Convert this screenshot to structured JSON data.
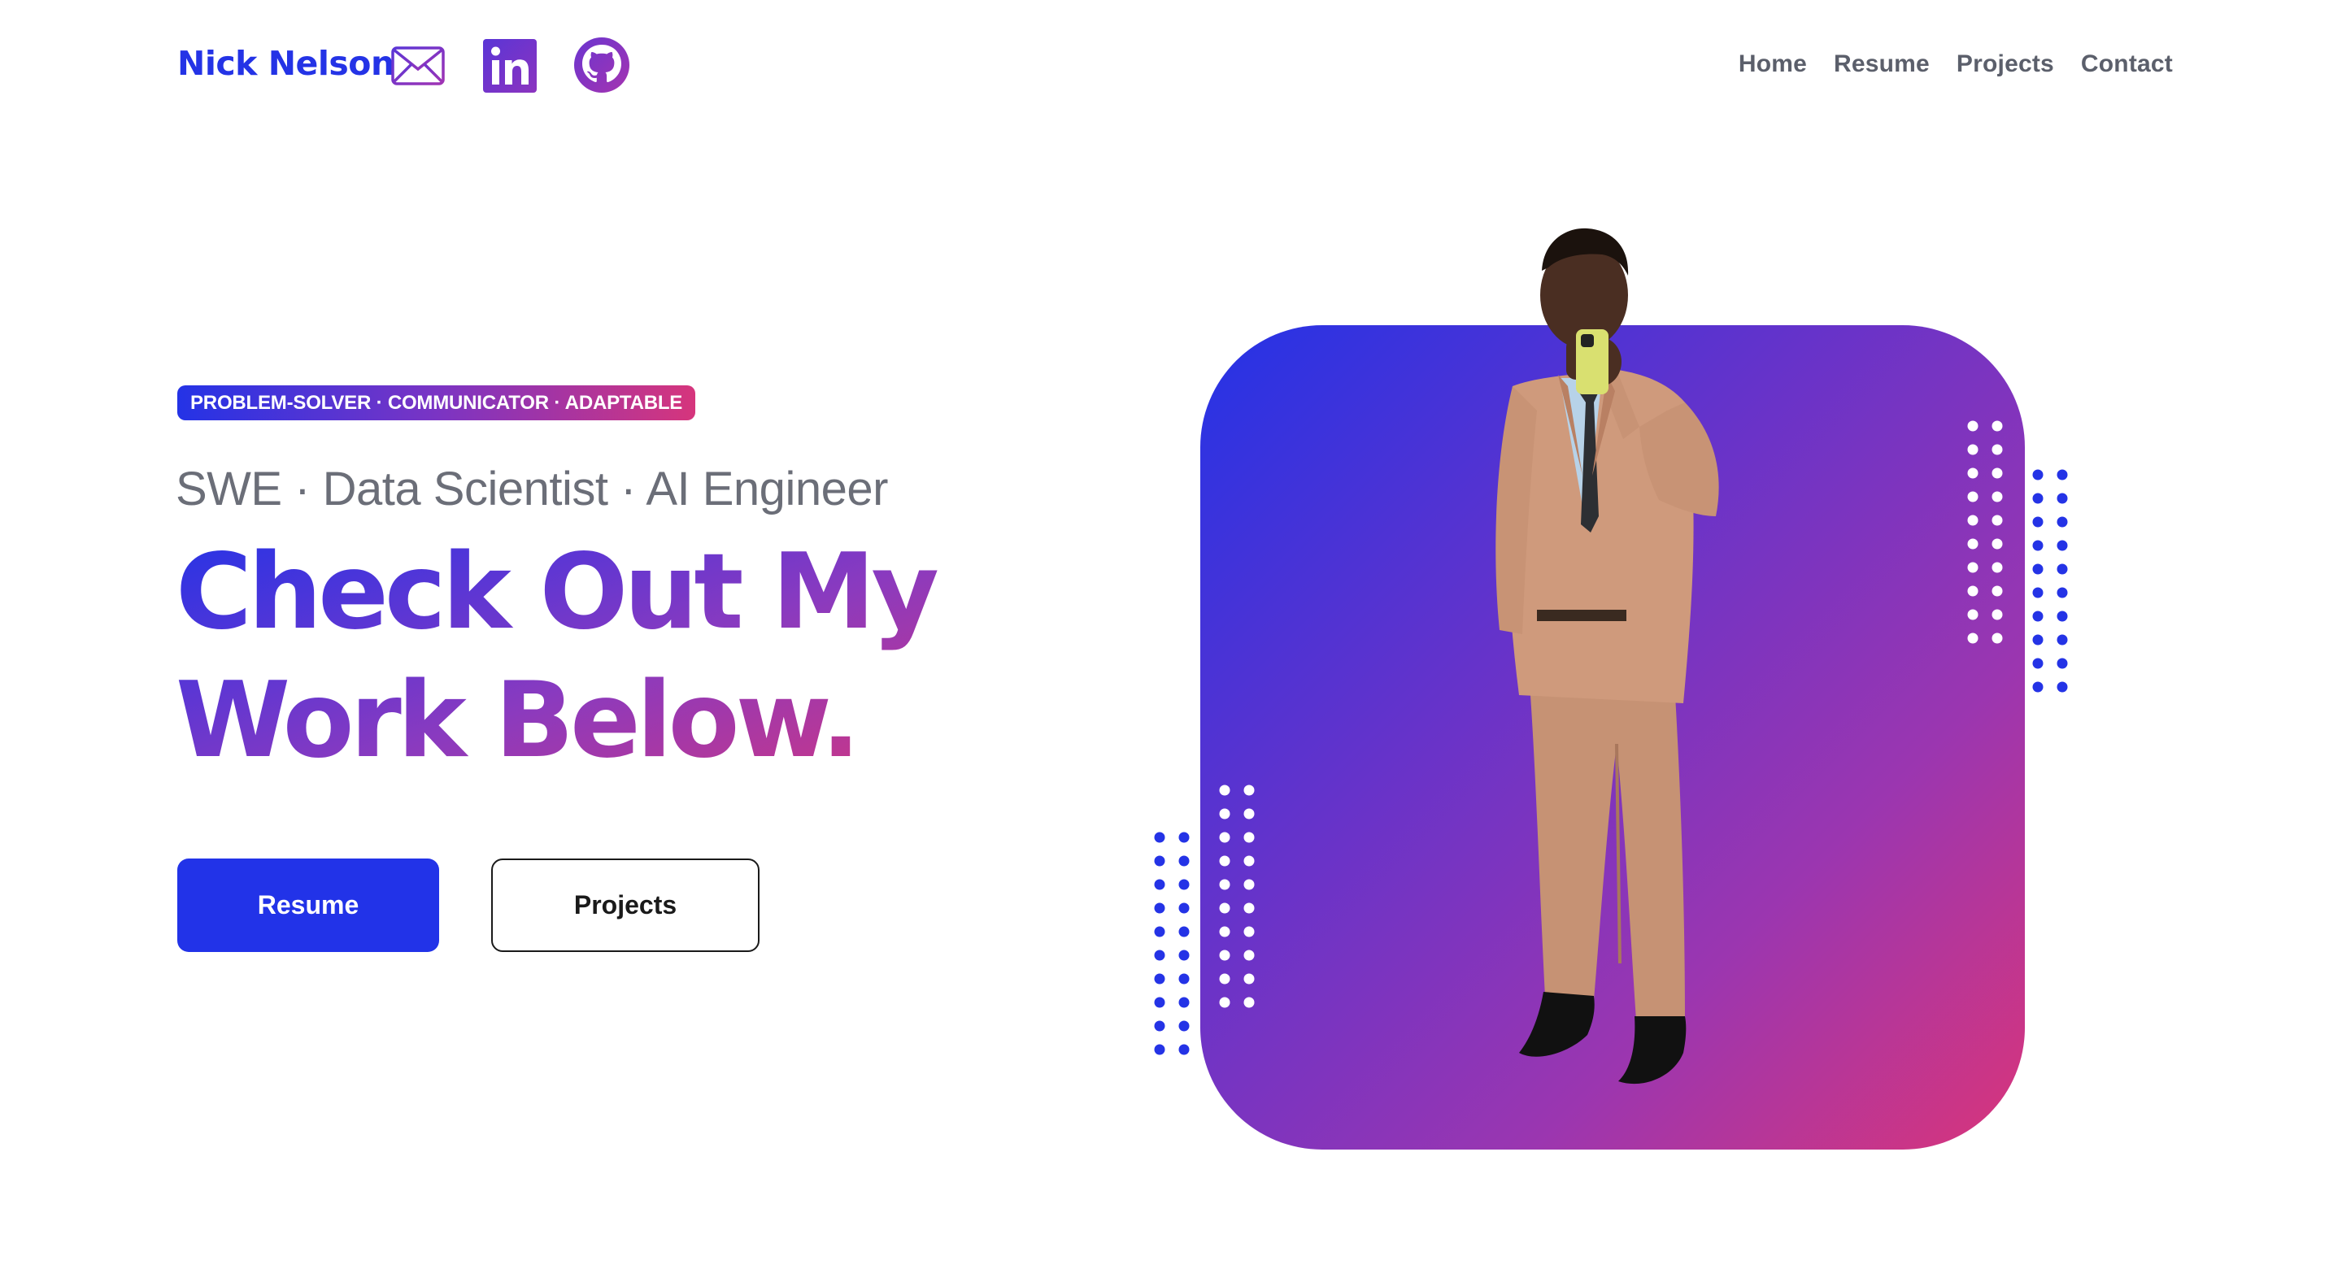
{
  "header": {
    "brand": "Nick Nelson",
    "social_icons": [
      "mail-icon",
      "linkedin-icon",
      "github-icon"
    ],
    "nav": {
      "home": "Home",
      "resume": "Resume",
      "projects": "Projects",
      "contact": "Contact"
    }
  },
  "hero": {
    "badge": "PROBLEM-SOLVER · COMMUNICATOR · ADAPTABLE",
    "subtitle": "SWE · Data Scientist · AI Engineer",
    "headline_line1": "Check Out My",
    "headline_line2": "Work Below.",
    "primary_button": "Resume",
    "secondary_button": "Projects"
  },
  "theme": {
    "accent_blue": "#2433e6",
    "accent_purple": "#7a34c4",
    "accent_pink": "#d6357c",
    "nav_text": "#5b5f6b"
  }
}
